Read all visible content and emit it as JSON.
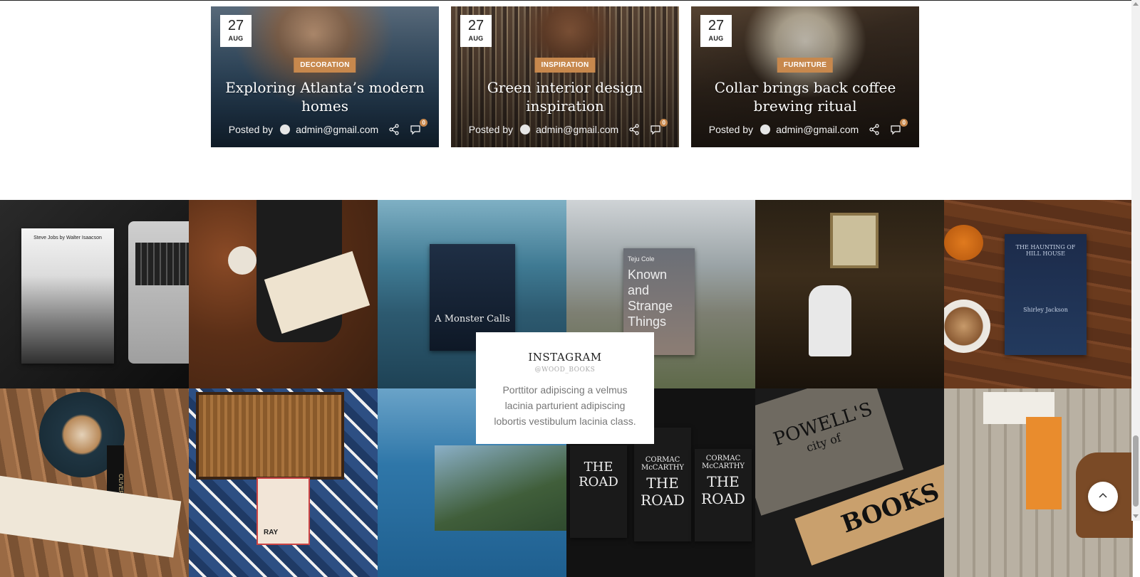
{
  "posts": [
    {
      "day": "27",
      "month": "AUG",
      "category": "DECORATION",
      "title": "Exploring Atlanta’s modern homes",
      "posted_by": "Posted by",
      "author": "admin@gmail.com",
      "comments": "0"
    },
    {
      "day": "27",
      "month": "AUG",
      "category": "INSPIRATION",
      "title": "Green interior design inspiration",
      "posted_by": "Posted by",
      "author": "admin@gmail.com",
      "comments": "0"
    },
    {
      "day": "27",
      "month": "AUG",
      "category": "FURNITURE",
      "title": "Collar brings back coffee brewing ritual",
      "posted_by": "Posted by",
      "author": "admin@gmail.com",
      "comments": "0"
    }
  ],
  "instagram": {
    "title": "INSTAGRAM",
    "handle": "@WOOD_BOOKS",
    "text": "Porttitor adipiscing a velmus lacinia parturient adipiscing lobortis vestibulum lacinia class.",
    "book_texts": {
      "jobs": "Steve Jobs by Walter Isaacson",
      "monster": "A Monster Calls",
      "cole_author": "Teju Cole",
      "cole_title": "Known and Strange Things",
      "road_author": "CORMAC McCARTHY",
      "road_title": "THE ROAD",
      "powells": "POWELL'S",
      "powells_city": "city of",
      "powells_books": "BOOKS",
      "hill_house": "THE HAUNTING OF HILL HOUSE",
      "hill_author": "Shirley Jackson",
      "oliver": "OLIVER",
      "ray": "RAY",
      "road_small": "THE ROAD"
    }
  },
  "colors": {
    "accent": "#c7884d"
  },
  "icons": {
    "share": "share-icon",
    "comment": "comment-icon",
    "back_to_top": "chevron-up-icon"
  }
}
